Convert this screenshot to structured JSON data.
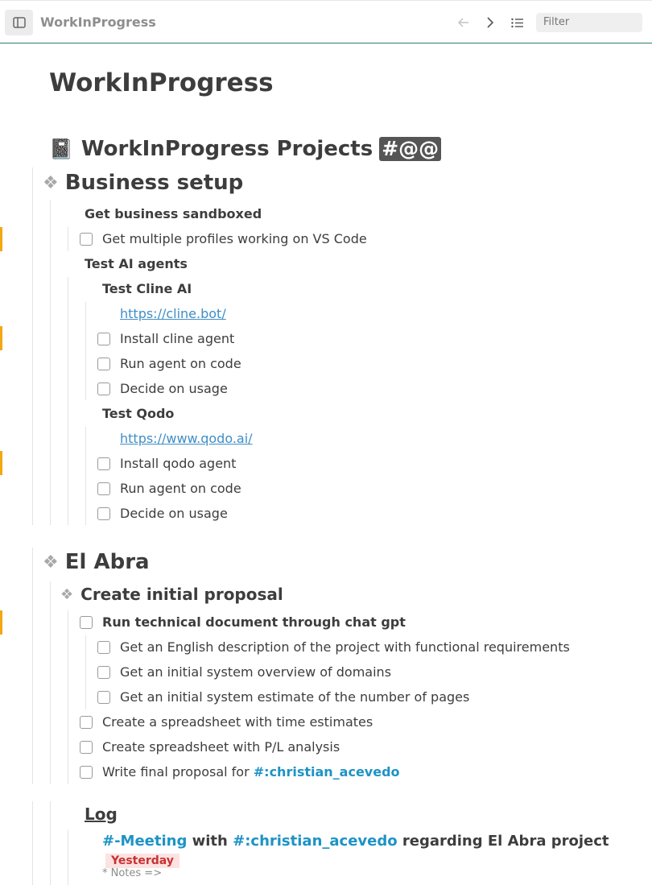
{
  "toolbar": {
    "title": "WorkInProgress",
    "filter_placeholder": "Filter",
    "icons": [
      "sidebar-toggle-icon",
      "back-arrow-icon",
      "forward-chevron-icon",
      "list-outline-icon"
    ]
  },
  "page": {
    "title": "WorkInProgress",
    "projects_heading": "WorkInProgress Projects",
    "projects_tag": "#@@"
  },
  "business": {
    "heading": "Business setup",
    "sandbox_heading": "Get business sandboxed",
    "sandbox_task": "Get multiple profiles working on VS Code",
    "ai_heading": "Test AI agents",
    "cline": {
      "heading": "Test Cline AI",
      "link": "https://cline.bot/",
      "tasks": [
        "Install cline agent",
        "Run agent on code",
        "Decide on usage"
      ]
    },
    "qodo": {
      "heading": "Test Qodo",
      "link": "https://www.qodo.ai/",
      "tasks": [
        "Install qodo agent",
        "Run agent on code",
        "Decide on usage"
      ]
    }
  },
  "abra": {
    "heading": "El Abra",
    "proposal_heading": "Create initial proposal",
    "tech_doc_task": "Run technical document through chat gpt",
    "subtasks": [
      "Get an English description of the project with functional requirements",
      "Get an initial system overview of domains",
      "Get an initial system estimate of the number of pages"
    ],
    "tasks": [
      "Create a spreadsheet with time estimates",
      "Create spreadsheet with P/L analysis"
    ],
    "final_task_prefix": "Write final proposal for ",
    "final_task_tag": "#:christian_acevedo"
  },
  "log": {
    "title": "Log",
    "meeting_tag": "#-Meeting",
    "with_text": " with ",
    "person_tag": "#:christian_acevedo",
    "suffix": " regarding El Abra project",
    "date": "Yesterday",
    "notes": "* Notes =>"
  },
  "colors": {
    "accent_line": "#2f7d6d",
    "marker": "#f3a712",
    "hashtag": "#1d93c5",
    "link": "#3f8ec7",
    "date_bg": "#fde2e2",
    "date_fg": "#c83232"
  }
}
